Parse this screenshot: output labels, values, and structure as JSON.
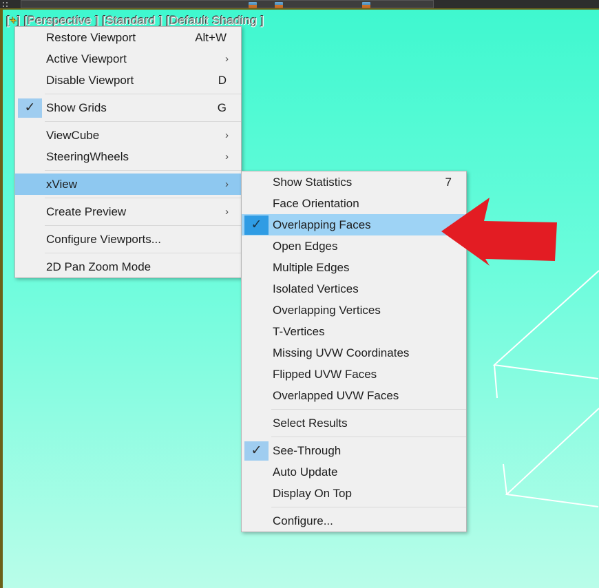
{
  "app": {
    "viewport_label": "[+] [Perspective ] [Standard ] [Default Shading ]",
    "viewport_label_plus": "+",
    "viewport_label_rest": "] [Perspective ] [Standard ] [Default Shading ]",
    "viewport_label_open": "[",
    "colors": {
      "viewport_bg_top": "#3ff8cf",
      "viewport_bg_bottom": "#b9fde9",
      "viewport_border": "#6b6119",
      "menu_bg": "#f0f0f0",
      "menu_border": "#b6b6b6",
      "highlight": "#8ec8f0",
      "check_gutter": "#9fcdf0",
      "check_gutter_selected": "#2f9ce4",
      "annotation_arrow": "#e31c23",
      "wireframe_line": "#ffffff",
      "toolbar_bg": "#2d2d2d"
    }
  },
  "viewport_menu": {
    "name": "viewport-right-click-menu",
    "items": [
      {
        "label": "Restore Viewport",
        "accel": "Alt+W",
        "checked": false,
        "submenu": false,
        "selected": false
      },
      {
        "label": "Active Viewport",
        "accel": "",
        "checked": false,
        "submenu": true,
        "selected": false
      },
      {
        "label": "Disable Viewport",
        "accel": "D",
        "checked": false,
        "submenu": false,
        "selected": false
      },
      {
        "separator": true
      },
      {
        "label": "Show Grids",
        "accel": "G",
        "checked": true,
        "submenu": false,
        "selected": false
      },
      {
        "separator": true
      },
      {
        "label": "ViewCube",
        "accel": "",
        "checked": false,
        "submenu": true,
        "selected": false
      },
      {
        "label": "SteeringWheels",
        "accel": "",
        "checked": false,
        "submenu": true,
        "selected": false
      },
      {
        "separator": true
      },
      {
        "label": "xView",
        "accel": "",
        "checked": false,
        "submenu": true,
        "selected": true
      },
      {
        "separator": true
      },
      {
        "label": "Create Preview",
        "accel": "",
        "checked": false,
        "submenu": true,
        "selected": false
      },
      {
        "separator": true
      },
      {
        "label": "Configure Viewports...",
        "accel": "",
        "checked": false,
        "submenu": false,
        "selected": false
      },
      {
        "separator": true
      },
      {
        "label": "2D Pan Zoom Mode",
        "accel": "",
        "checked": false,
        "submenu": false,
        "selected": false
      }
    ]
  },
  "xview_menu": {
    "name": "xview-submenu",
    "items": [
      {
        "label": "Show Statistics",
        "accel": "7",
        "checked": false,
        "selected": false
      },
      {
        "label": "Face Orientation",
        "accel": "",
        "checked": false,
        "selected": false
      },
      {
        "label": "Overlapping Faces",
        "accel": "",
        "checked": true,
        "selected": true
      },
      {
        "label": "Open Edges",
        "accel": "",
        "checked": false,
        "selected": false
      },
      {
        "label": "Multiple Edges",
        "accel": "",
        "checked": false,
        "selected": false
      },
      {
        "label": "Isolated Vertices",
        "accel": "",
        "checked": false,
        "selected": false
      },
      {
        "label": "Overlapping Vertices",
        "accel": "",
        "checked": false,
        "selected": false
      },
      {
        "label": "T-Vertices",
        "accel": "",
        "checked": false,
        "selected": false
      },
      {
        "label": "Missing UVW Coordinates",
        "accel": "",
        "checked": false,
        "selected": false
      },
      {
        "label": "Flipped UVW Faces",
        "accel": "",
        "checked": false,
        "selected": false
      },
      {
        "label": "Overlapped UVW Faces",
        "accel": "",
        "checked": false,
        "selected": false
      },
      {
        "separator": true
      },
      {
        "label": "Select Results",
        "accel": "",
        "checked": false,
        "selected": false
      },
      {
        "separator": true
      },
      {
        "label": "See-Through",
        "accel": "",
        "checked": true,
        "selected": false
      },
      {
        "label": "Auto Update",
        "accel": "",
        "checked": false,
        "selected": false
      },
      {
        "label": "Display On Top",
        "accel": "",
        "checked": false,
        "selected": false
      },
      {
        "separator": true
      },
      {
        "label": "Configure...",
        "accel": "",
        "checked": false,
        "selected": false
      }
    ]
  },
  "annotation": {
    "type": "arrow",
    "direction": "left",
    "points_at": "Overlapping Faces",
    "color": "#e31c23"
  },
  "icons": {
    "check": "✓",
    "submenu_arrow": "›"
  }
}
